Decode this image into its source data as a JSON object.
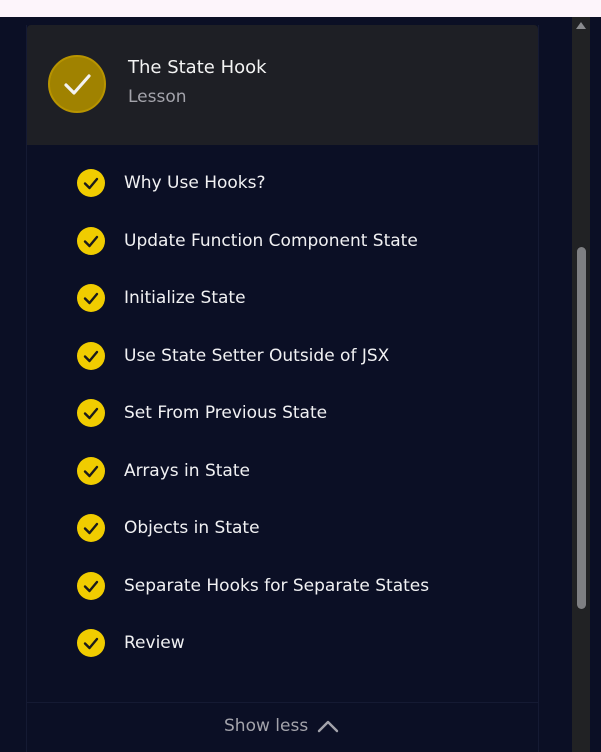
{
  "header": {
    "title": "The State Hook",
    "subtitle": "Lesson",
    "completed_icon": "check-icon"
  },
  "items": [
    {
      "label": "Why Use Hooks?",
      "status": "completed"
    },
    {
      "label": "Update Function Component State",
      "status": "completed"
    },
    {
      "label": "Initialize State",
      "status": "completed"
    },
    {
      "label": "Use State Setter Outside of JSX",
      "status": "completed"
    },
    {
      "label": "Set From Previous State",
      "status": "completed"
    },
    {
      "label": "Arrays in State",
      "status": "completed"
    },
    {
      "label": "Objects in State",
      "status": "completed"
    },
    {
      "label": "Separate Hooks for Separate States",
      "status": "completed"
    },
    {
      "label": "Review",
      "status": "completed"
    }
  ],
  "footer": {
    "show_less_label": "Show less",
    "icon": "chevron-up-icon"
  },
  "colors": {
    "background": "#0b0f25",
    "header_bg": "#1e1f25",
    "check_yellow": "#f0cc00",
    "check_dark_gold": "#a08200",
    "muted_text": "#a3a3ab"
  }
}
